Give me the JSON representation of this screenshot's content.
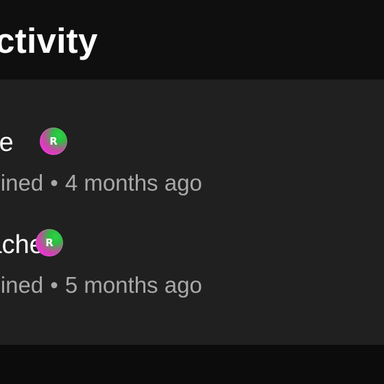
{
  "header": {
    "title": "Activity"
  },
  "members": [
    {
      "name": "Dee",
      "badge_letter": "R",
      "status": "Joined",
      "separator": "•",
      "time": "4 months ago"
    },
    {
      "name": "Rachel",
      "badge_letter": "R",
      "status": "Joined",
      "separator": "•",
      "time": "5 months ago"
    }
  ],
  "colors": {
    "background": "#0e0e0e",
    "panel": "#202020",
    "primary_text": "#ffffff",
    "secondary_text": "#a8a8a8",
    "badge_pink": "#ee2fd8",
    "badge_green": "#2fd04a"
  },
  "icons": {
    "badge": "member-badge-icon"
  }
}
